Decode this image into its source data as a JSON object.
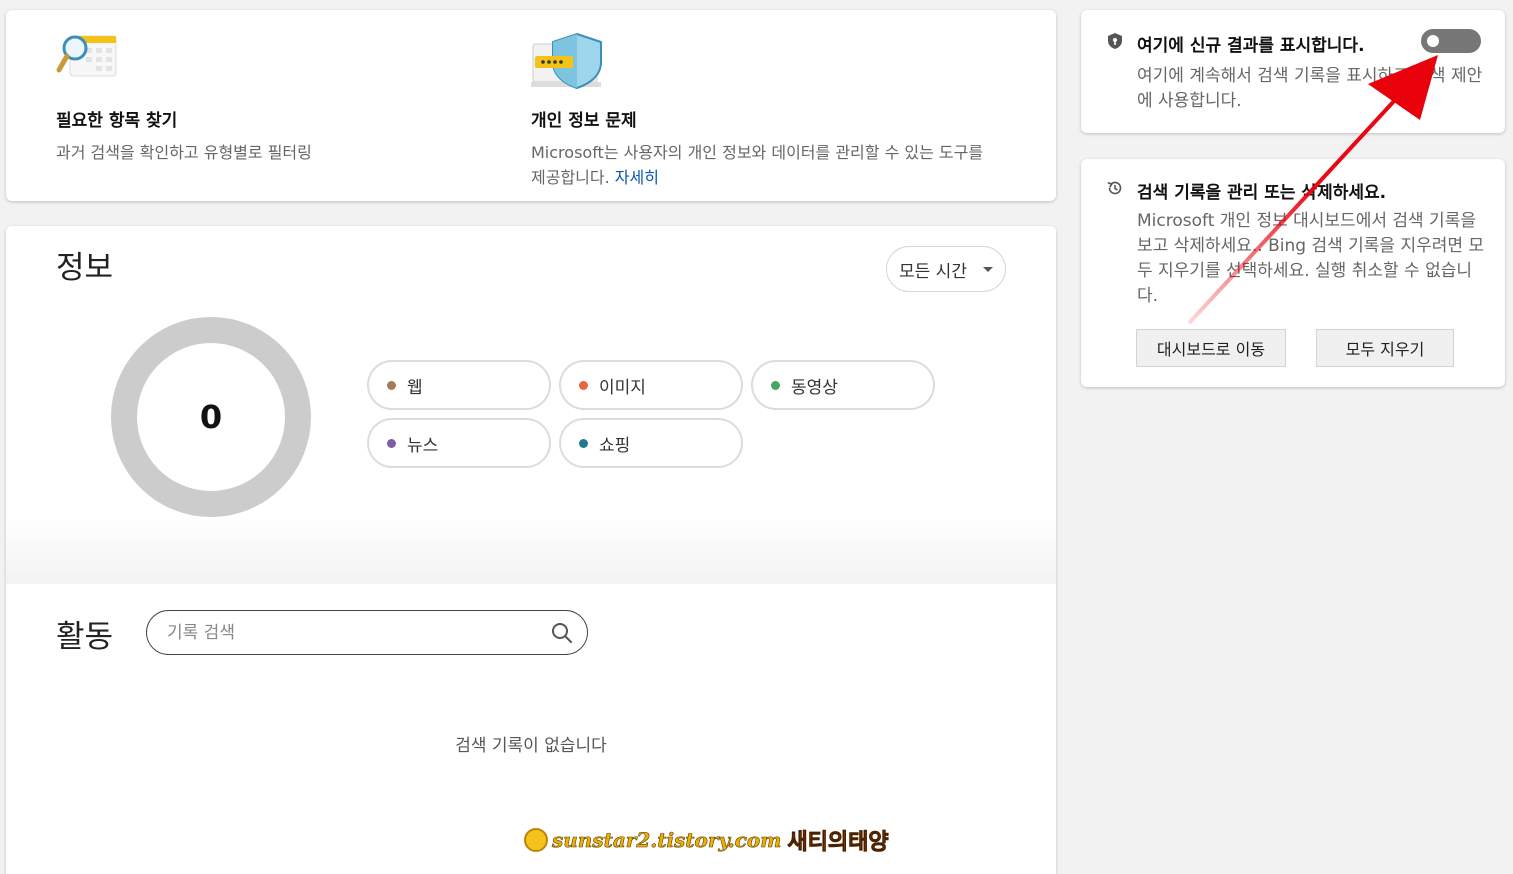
{
  "top_card": {
    "find": {
      "title": "필요한 항목 찾기",
      "desc": "과거 검색을 확인하고 유형별로 필터링"
    },
    "privacy": {
      "title": "개인 정보 문제",
      "desc": "Microsoft는 사용자의 개인 정보와 데이터를 관리할 수 있는 도구를 제공합니다.",
      "link": "자세히"
    }
  },
  "info": {
    "title": "정보",
    "time_filter": "모든 시간",
    "total": "0",
    "categories": [
      {
        "label": "웹",
        "color": "#a57c52"
      },
      {
        "label": "이미지",
        "color": "#e4683c"
      },
      {
        "label": "동영상",
        "color": "#4aa563"
      },
      {
        "label": "뉴스",
        "color": "#7e5ea8"
      },
      {
        "label": "쇼핑",
        "color": "#217a8f"
      }
    ]
  },
  "activity": {
    "title": "활동",
    "search_placeholder": "기록 검색",
    "empty": "검색 기록이 없습니다"
  },
  "toggle_card": {
    "title": "여기에 신규 결과를 표시합니다.",
    "desc": "여기에 계속해서 검색 기록을 표시하고 검색 제안에 사용합니다.",
    "toggle_on": false
  },
  "history_card": {
    "title": "검색 기록을 관리 또는 삭제하세요.",
    "desc": "Microsoft 개인 정보 대시보드에서 검색 기록을 보고 삭제하세요.. Bing 검색 기록을 지우려면 모두 지우기를 선택하세요. 실행 취소할 수 없습니다.",
    "dashboard_button": "대시보드로 이동",
    "clear_button": "모두 지우기"
  },
  "watermark": {
    "url": "sunstar2.tistory.com",
    "name": "새티의태양"
  },
  "colors": {
    "accent_link": "#0b57b5",
    "annotation_arrow": "#e8000b"
  }
}
